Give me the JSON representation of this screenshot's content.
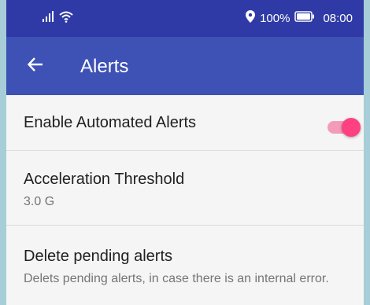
{
  "status_bar": {
    "battery": "100%",
    "time": "08:00",
    "icons": [
      "signal-icon",
      "wifi-icon",
      "location-icon",
      "battery-icon"
    ]
  },
  "app_bar": {
    "title": "Alerts",
    "back_icon": "back-arrow-icon"
  },
  "settings": {
    "enable_alerts": {
      "title": "Enable Automated Alerts",
      "enabled": true
    },
    "acceleration_threshold": {
      "title": "Acceleration Threshold",
      "summary": "3.0 G"
    },
    "delete_pending": {
      "title": "Delete pending alerts",
      "summary": "Delets pending alerts, in case there is an internal error."
    }
  },
  "colors": {
    "status_bar": "#2f3aa6",
    "app_bar": "#3e51b5",
    "accent": "#ff4081",
    "background": "#f5f5f5"
  }
}
